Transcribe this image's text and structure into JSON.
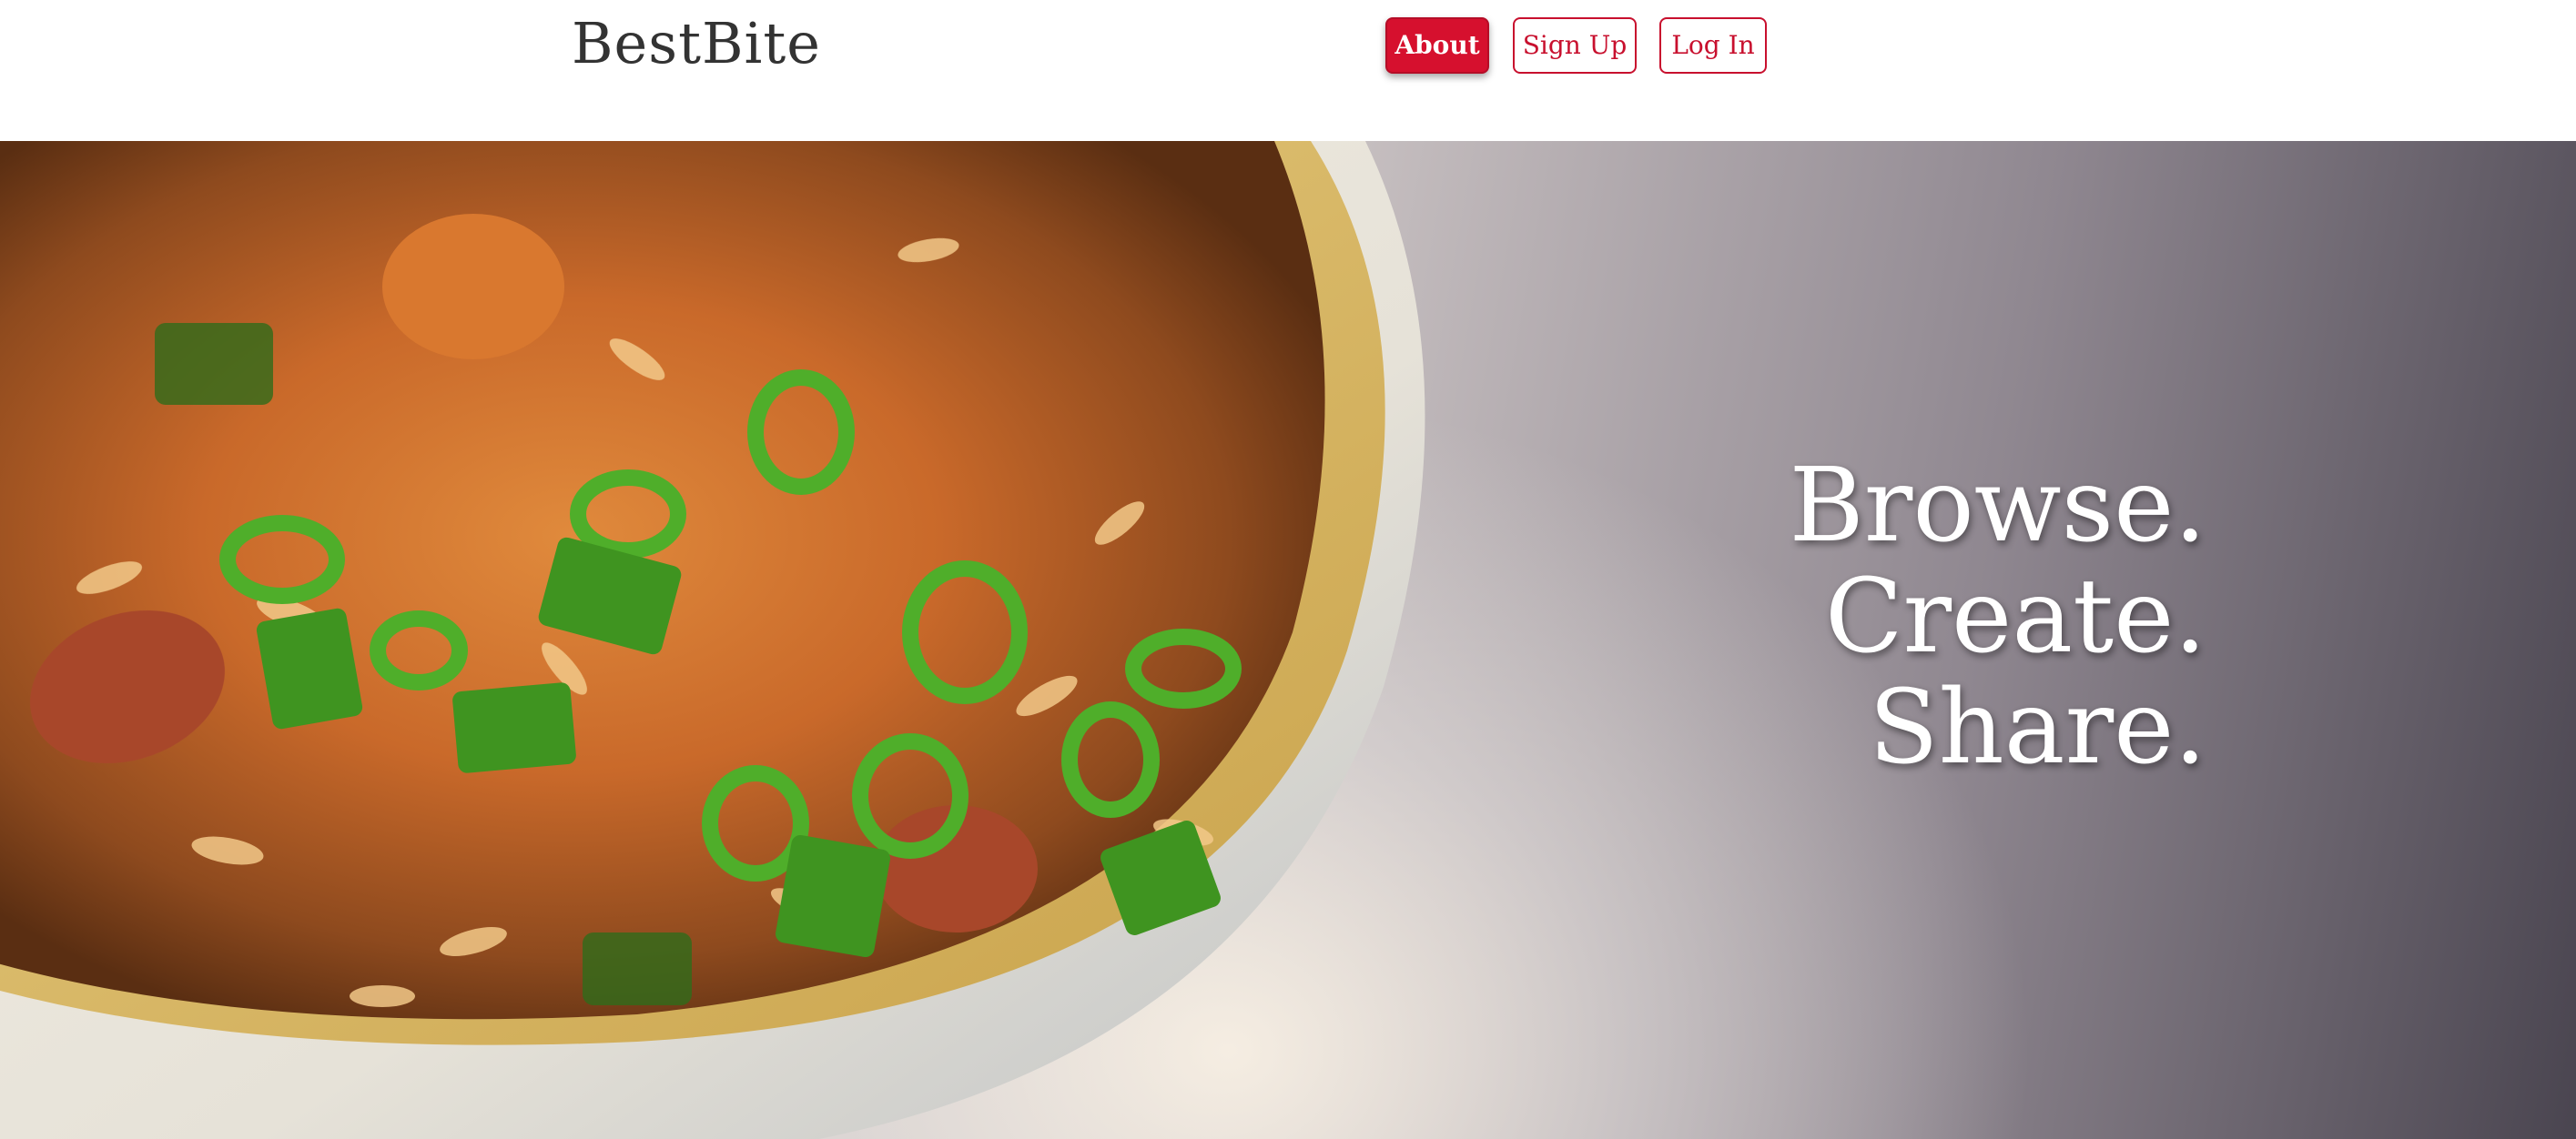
{
  "header": {
    "brand": "BestBite",
    "nav": [
      {
        "label": "About",
        "active": true
      },
      {
        "label": "Sign Up",
        "active": false
      },
      {
        "label": "Log In",
        "active": false
      }
    ]
  },
  "hero": {
    "tagline": [
      "Browse.",
      "Create.",
      "Share."
    ],
    "image": "food-bowl-photo"
  },
  "colors": {
    "accent": "#d6102e",
    "brand_text": "#333333",
    "tagline_text": "#ffffff"
  }
}
